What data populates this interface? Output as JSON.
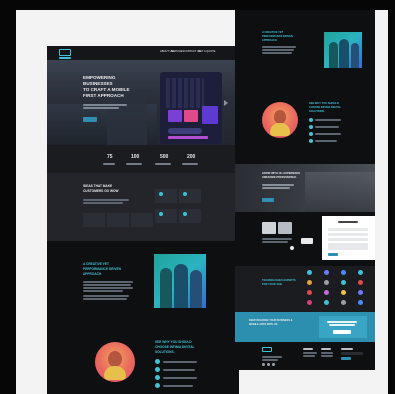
{
  "colors": {
    "accent": "#3fc1d6",
    "page_bg": "#1b1c20",
    "button": "#2f8fb3"
  },
  "left_mock": {
    "header": {
      "logo_icon": "phone-logo-icon",
      "nav": [
        "ABOUT US",
        "SERVICES",
        "CONTACT US",
        "GET A QUOTE"
      ]
    },
    "hero": {
      "headline": [
        "EMPOWERING",
        "BUSINESSES",
        "TO CRAFT A MOBILE",
        "FIRST APPROACH"
      ],
      "cta_icon": "arrow-right-icon"
    },
    "stats": [
      "75",
      "100",
      "500",
      "200"
    ],
    "ideas": {
      "title": [
        "IDEAS THAT MAKE",
        "CUSTOMERS GO WOW"
      ]
    },
    "creative": {
      "title": [
        "A CREATIVE YET",
        "PERFORMANCE DRIVEN",
        "APPROACH"
      ]
    },
    "why": {
      "title": [
        "SEE WHY YOU SHOULD",
        "CHOOSE INFINIA DIGITAL",
        "SOLUTIONS."
      ],
      "check_icon": "check-circle-icon"
    }
  },
  "right_mock": {
    "creative": {
      "title": [
        "A CREATIVE YET",
        "PERFORMANCE DRIVEN",
        "APPROACH"
      ]
    },
    "why": {
      "title": [
        "SEE WHY YOU SHOULD",
        "CHOOSE INFINIA DIGITAL",
        "SOLUTIONS."
      ]
    },
    "dark_band": {
      "title": [
        "GROW WITH 10+ EXPERIENCE",
        "AWESOME PROFESSIONAL"
      ]
    },
    "technologies": {
      "title": [
        "TECHNOLOGIES EXPERTS",
        "FOR YOUR JOB"
      ]
    },
    "banner": {
      "title": [
        "KEEP BUILDING YOUR BUSINESS &",
        "MOBILE APPS WITH US"
      ]
    }
  }
}
